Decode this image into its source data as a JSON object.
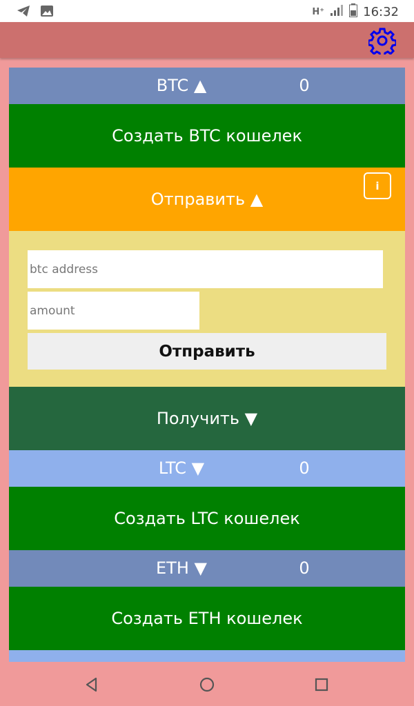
{
  "status_bar": {
    "network": "H⁺",
    "time": "16:32"
  },
  "colors": {
    "header_dark": "#728aba",
    "header_light": "#8fb0ec",
    "create_green": "#008000",
    "send_orange": "#ffa500",
    "panel_yellow": "#ecdd82",
    "receive_green": "#25673e",
    "background": "#f09a9a",
    "appbar": "#cc706e",
    "gear_blue": "#0000ee"
  },
  "btc": {
    "header": "BTC ▲",
    "balance": "0",
    "create_label": "Создать BTC кошелек",
    "send_label": "Отправить  ▲",
    "info_label": "i",
    "address_placeholder": "btc address",
    "amount_placeholder": "amount",
    "submit_label": "Отправить",
    "receive_label": "Получить  ▼"
  },
  "ltc": {
    "header": "LTC ▼",
    "balance": "0",
    "create_label": "Создать LTC кошелек"
  },
  "eth": {
    "header": "ETH ▼",
    "balance": "0",
    "create_label": "Создать ETH кошелек"
  }
}
